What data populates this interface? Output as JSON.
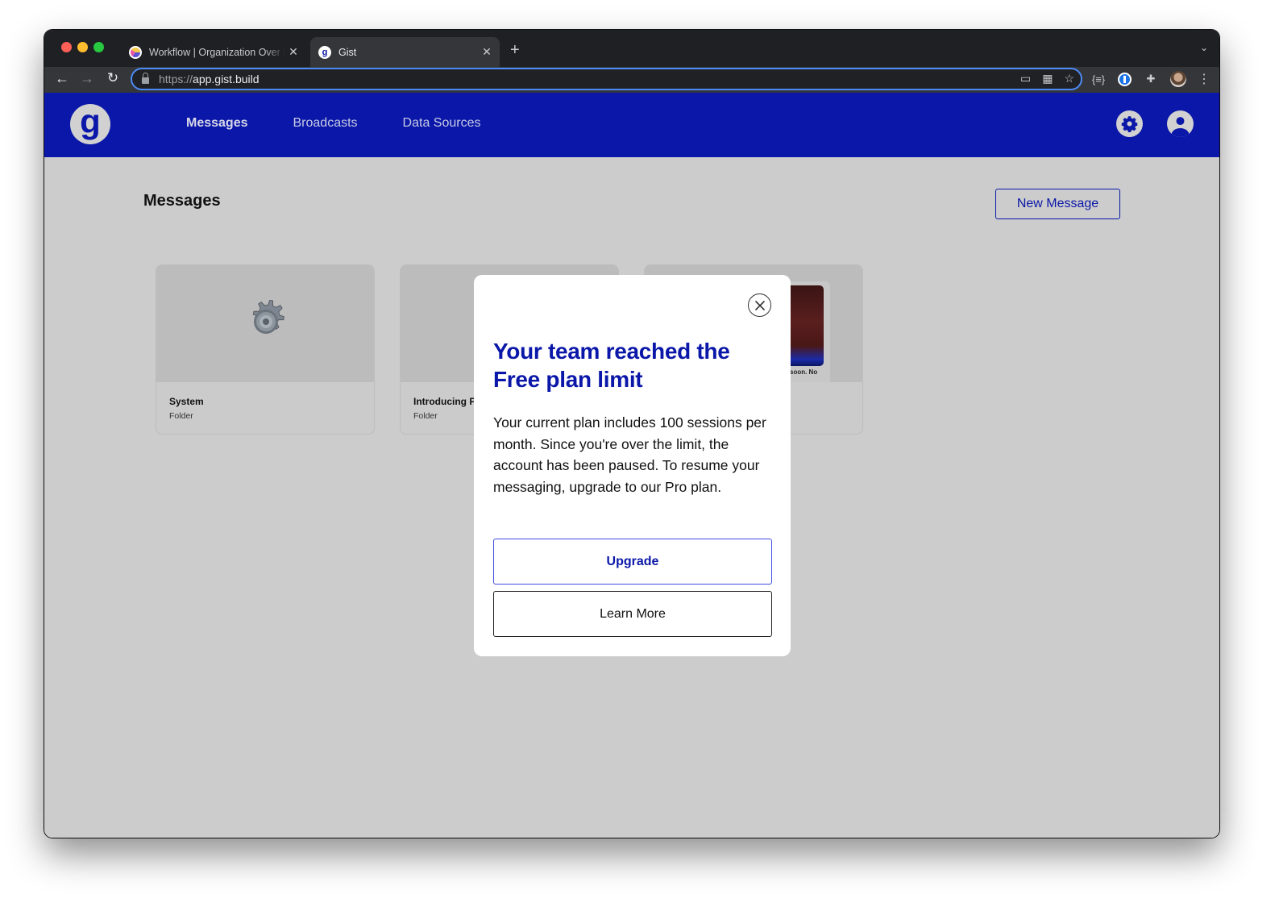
{
  "browser": {
    "tabs": [
      {
        "title": "Workflow | Organization Over L",
        "favicon": "workflow-favicon",
        "active": false
      },
      {
        "title": "Gist",
        "favicon": "gist-favicon",
        "active": true
      }
    ],
    "new_tab_label": "+",
    "url_scheme": "https://",
    "url_host": "app.gist.build",
    "tab_close_glyph": "✕"
  },
  "app": {
    "logo_letter": "g",
    "nav": [
      {
        "label": "Messages",
        "active": true
      },
      {
        "label": "Broadcasts",
        "active": false
      },
      {
        "label": "Data Sources",
        "active": false
      }
    ],
    "colors": {
      "brand": "#0a17a8",
      "background": "#cccccc"
    }
  },
  "page": {
    "title": "Messages",
    "new_message_label": "New Message",
    "cards": [
      {
        "name": "System",
        "type": "Folder",
        "thumb": "gear-icon"
      },
      {
        "name": "Introducing F",
        "type": "Folder",
        "thumb": "none"
      },
      {
        "name": "",
        "type": "",
        "thumb": "video-preview",
        "caption": "soon. No"
      }
    ]
  },
  "modal": {
    "title": "Your team reached the Free plan limit",
    "body": "Your current plan includes 100 sessions per month. Since you're over the limit, the account has been paused. To resume your messaging, upgrade to our Pro plan.",
    "upgrade_label": "Upgrade",
    "learn_more_label": "Learn More"
  }
}
